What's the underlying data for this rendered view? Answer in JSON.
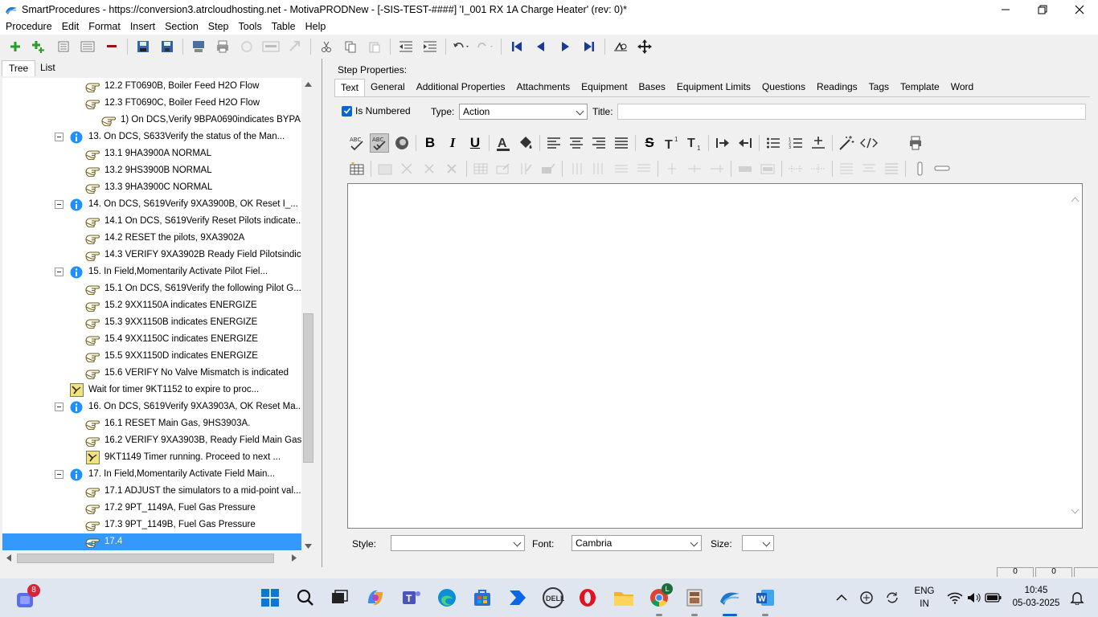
{
  "window": {
    "title": "SmartProcedures - https://conversion3.atrcloudhosting.net - MotivaPRODNew - [-SIS-TEST-####] 'I_001 RX 1A Charge Heater' (rev: 0)*"
  },
  "menu": [
    "Procedure",
    "Edit",
    "Format",
    "Insert",
    "Section",
    "Step",
    "Tools",
    "Table",
    "Help"
  ],
  "left_tabs": [
    "Tree",
    "List"
  ],
  "tree_items": [
    {
      "text": "12.2 FT0690B, Boiler Feed H2O Flow",
      "icon": "step-hand-icon",
      "selected": false
    },
    {
      "text": "12.3 FT0690C, Boiler Feed H2O Flow",
      "icon": "step-hand-icon",
      "selected": false
    },
    {
      "text": "1) On DCS,Verify  9BPA0690indicates  BYPA...",
      "icon": "step-hand-icon",
      "selected": false
    },
    {
      "text": "13. On DCS, S633Verify the status of the Man...",
      "icon": "info-icon",
      "selected": false
    },
    {
      "text": "13.1 9HA3900A        NORMAL",
      "icon": "step-hand-icon",
      "selected": false
    },
    {
      "text": "13.2 9HS3900B        NORMAL",
      "icon": "step-hand-icon",
      "selected": false
    },
    {
      "text": "13.3 9HA3900C        NORMAL",
      "icon": "step-hand-icon",
      "selected": false
    },
    {
      "text": "14. On DCS, S619Verify 9XA3900B, OK Reset I_...",
      "icon": "info-icon",
      "selected": false
    },
    {
      "text": "14.1 On DCS, S619Verify Reset Pilots indicate...",
      "icon": "step-hand-icon",
      "selected": false
    },
    {
      "text": "14.2 RESET the pilots, 9XA3902A",
      "icon": "step-hand-icon",
      "selected": false
    },
    {
      "text": "14.3 VERIFY 9XA3902B Ready Field Pilotsindic...",
      "icon": "step-hand-icon",
      "selected": false
    },
    {
      "text": "15. In Field,Momentarily Activate Pilot Fiel...",
      "icon": "info-icon",
      "selected": false
    },
    {
      "text": "15.1 On DCS, S619Verify the following Pilot G...",
      "icon": "step-hand-icon",
      "selected": false
    },
    {
      "text": "15.2 9XX1150A indicates ENERGIZE",
      "icon": "step-hand-icon",
      "selected": false
    },
    {
      "text": "15.3 9XX1150B indicates ENERGIZE",
      "icon": "step-hand-icon",
      "selected": false
    },
    {
      "text": "15.4 9XX1150C indicates ENERGIZE",
      "icon": "step-hand-icon",
      "selected": false
    },
    {
      "text": "15.5 9XX1150D indicates ENERGIZE",
      "icon": "step-hand-icon",
      "selected": false
    },
    {
      "text": "15.6 VERIFY No Valve Mismatch is indicated",
      "icon": "step-hand-icon",
      "selected": false
    },
    {
      "text": "Wait for timer 9KT1152 to expire to proc...",
      "icon": "timer-icon",
      "selected": false
    },
    {
      "text": "16. On DCS, S619Verify 9XA3903A, OK Reset Ma...",
      "icon": "info-icon",
      "selected": false
    },
    {
      "text": "16.1 RESET Main Gas, 9HS3903A.",
      "icon": "step-hand-icon",
      "selected": false
    },
    {
      "text": "16.2 VERIFY 9XA3903B, Ready Field Main Gasi...",
      "icon": "step-hand-icon",
      "selected": false
    },
    {
      "text": "9KT1149 Timer running.  Proceed to next ...",
      "icon": "timer-icon",
      "selected": false
    },
    {
      "text": "17. In Field,Momentarily Activate Field Main...",
      "icon": "info-icon",
      "selected": false
    },
    {
      "text": "17.1 ADJUST the simulators to a mid-point val...",
      "icon": "step-hand-icon",
      "selected": false
    },
    {
      "text": "17.2 9PT_1149A, Fuel Gas Pressure",
      "icon": "step-hand-icon",
      "selected": false
    },
    {
      "text": "17.3 9PT_1149B, Fuel Gas Pressure",
      "icon": "step-hand-icon",
      "selected": false
    },
    {
      "text": "17.4",
      "icon": "step-hand-icon",
      "selected": true
    }
  ],
  "right": {
    "step_properties_label": "Step Properties:",
    "tabs": [
      "Text",
      "General",
      "Additional Properties",
      "Attachments",
      "Equipment",
      "Bases",
      "Equipment Limits",
      "Questions",
      "Readings",
      "Tags",
      "Template",
      "Word"
    ],
    "is_numbered_label": "Is Numbered",
    "type_label": "Type:",
    "type_value": "Action",
    "title_label": "Title:",
    "title_value": "",
    "style_label": "Style:",
    "style_value": "",
    "font_label": "Font:",
    "font_value": "Cambria",
    "size_label": "Size:",
    "size_value": ""
  },
  "status": {
    "box1": "0",
    "box2": "0"
  },
  "taskbar": {
    "notification_badge": "8",
    "chrome_badge": "L",
    "lang_line1": "ENG",
    "lang_line2": "IN",
    "time": "10:45",
    "date": "05-03-2025"
  },
  "colors": {
    "selection": "#3399ff",
    "info_icon": "#1e90ff",
    "checkbox": "#0a64d0"
  }
}
